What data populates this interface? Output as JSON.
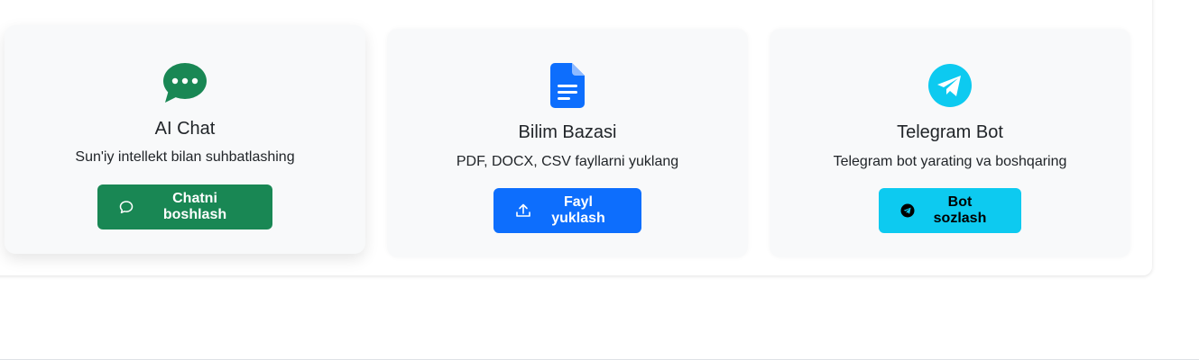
{
  "cards": [
    {
      "title": "AI Chat",
      "description": "Sun'iy intellekt bilan suhbatlashing",
      "button_label": "Chatni boshlash",
      "icon": "chat-dots-icon",
      "accent": "#198754"
    },
    {
      "title": "Bilim Bazasi",
      "description": "PDF, DOCX, CSV fayllarni yuklang",
      "button_label": "Fayl yuklash",
      "icon": "document-icon",
      "accent": "#0d6efd"
    },
    {
      "title": "Telegram Bot",
      "description": "Telegram bot yarating va boshqaring",
      "button_label": "Bot sozlash",
      "icon": "telegram-icon",
      "accent": "#0dcaf0"
    }
  ]
}
